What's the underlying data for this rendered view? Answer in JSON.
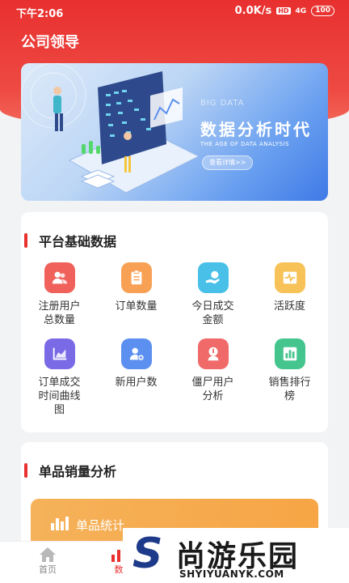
{
  "status": {
    "time": "下午2:06",
    "speed": "0.0K/s",
    "hd": "HD",
    "signal": "4G",
    "battery": "100"
  },
  "header": {
    "title": "公司领导"
  },
  "banner": {
    "sup": "BIG DATA",
    "title": "数据分析时代",
    "subtitle": "THE AGE OF DATA ANALYSIS",
    "button": "查看详情>>"
  },
  "platform": {
    "title": "平台基础数据",
    "items": [
      {
        "label": "注册用户总数量",
        "color": "#f0615c",
        "icon": "users-icon"
      },
      {
        "label": "订单数量",
        "color": "#f8a155",
        "icon": "clipboard-icon"
      },
      {
        "label": "今日成交金额",
        "color": "#48c0e8",
        "icon": "money-hand-icon"
      },
      {
        "label": "活跃度",
        "color": "#f7c257",
        "icon": "pulse-icon"
      },
      {
        "label": "订单成交时间曲线图",
        "color": "#7a6ae6",
        "icon": "line-chart-icon"
      },
      {
        "label": "新用户数",
        "color": "#5b8ff0",
        "icon": "user-add-icon"
      },
      {
        "label": "僵尸用户分析",
        "color": "#f06a6a",
        "icon": "zombie-icon"
      },
      {
        "label": "销售排行榜",
        "color": "#44c58e",
        "icon": "ranking-icon"
      }
    ]
  },
  "product": {
    "title": "单品销量分析",
    "stat_label": "单品统计"
  },
  "tabbar": {
    "home": "首页",
    "data": "数"
  },
  "watermark": {
    "brand": "S",
    "name": "尚游乐园",
    "url": "SHYIYUANYK.COM"
  }
}
